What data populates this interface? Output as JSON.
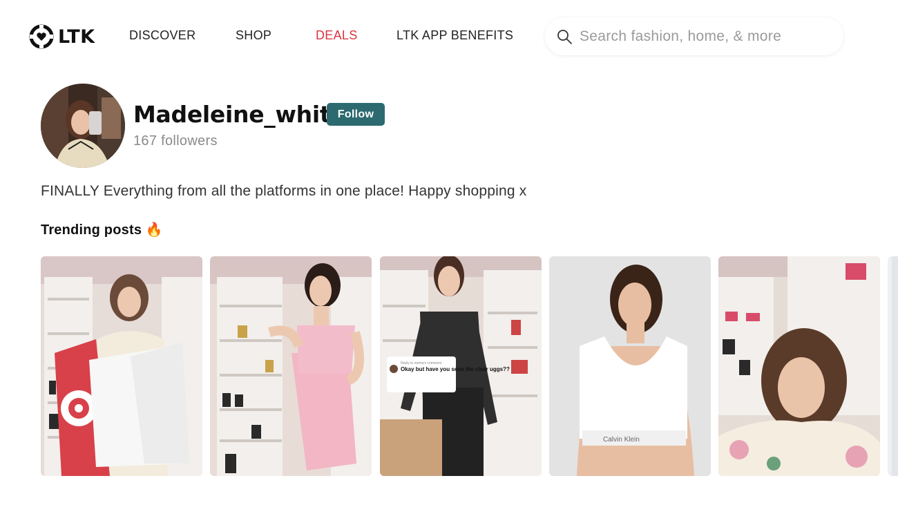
{
  "header": {
    "logo_text": "LTK",
    "nav": {
      "discover": "DISCOVER",
      "shop": "SHOP",
      "deals": "DEALS",
      "benefits": "LTK APP BENEFITS"
    },
    "deals_color": "#d9353f",
    "search": {
      "placeholder": "Search fashion, home, & more",
      "value": ""
    }
  },
  "profile": {
    "username": "Madeleine_white",
    "follow_label": "Follow",
    "followers": "167 followers",
    "bio": "FINALLY Everything from all the platforms in one place! Happy shopping x",
    "accent_color": "#2c6a70"
  },
  "trending": {
    "title": "Trending posts 🔥",
    "posts": [
      {
        "caption": ""
      },
      {
        "caption": ""
      },
      {
        "caption": "",
        "comment_reply_to": "Reply to mema's comment",
        "comment_text": "Okay but have you seen the clear uggs??"
      },
      {
        "caption": "",
        "brand_text": "Calvin Klein"
      },
      {
        "caption": ""
      },
      {
        "caption": ""
      }
    ]
  }
}
